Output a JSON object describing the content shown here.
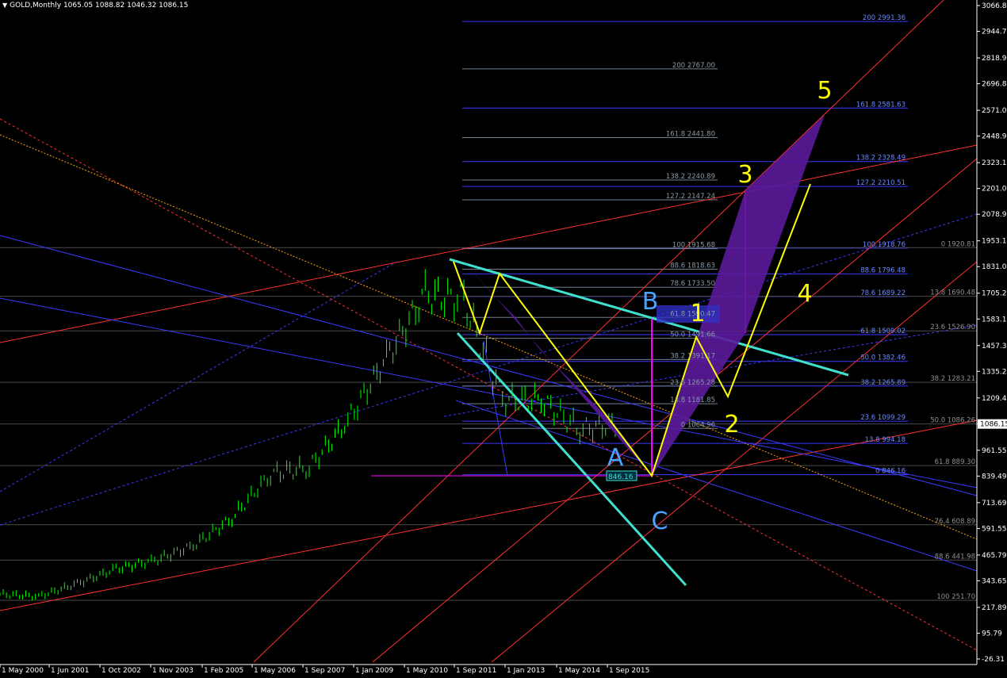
{
  "header": {
    "symbol": "GOLD,Monthly",
    "ohlc": "1065.05 1088.82 1046.32 1086.15",
    "menu_icon": "triangle-down-icon"
  },
  "colors": {
    "background": "#000000",
    "grid": "#4a4a4a",
    "candles": "#00ff00",
    "fib_blue": "#3a3aff",
    "fib_gray": "#708090",
    "channel_orange": "#ff4500",
    "channel_red": "#ff3030",
    "cyan": "#40e0d0",
    "yellow": "#ffff00",
    "magenta": "#ff00ff",
    "purple": "#5a1a9a",
    "label_blue": "#4aa3ff",
    "label_yellow": "#ffff00",
    "axis_text": "#ffffff"
  },
  "chart_data": {
    "type": "candlestick",
    "title": "GOLD,Monthly",
    "ylim": [
      -26.31,
      3066.89
    ],
    "y_ticks": [
      "3066.89",
      "2944.75",
      "2818.99",
      "2696.86",
      "2571.09",
      "2448.96",
      "2323.19",
      "2201.05",
      "2078.92",
      "1953.15",
      "1831.02",
      "1705.25",
      "1583.12",
      "1457.35",
      "1335.21",
      "1209.45",
      "1086.15",
      "961.55",
      "839.49",
      "713.69",
      "591.55",
      "465.79",
      "343.65",
      "217.89",
      "95.79",
      "-26.31"
    ],
    "x_ticks": [
      "1 May 2000",
      "1 Jun 2001",
      "1 Oct 2002",
      "1 Nov 2003",
      "1 Feb 2005",
      "1 May 2006",
      "1 Sep 2007",
      "1 Jan 2009",
      "1 May 2010",
      "1 Sep 2011",
      "1 Jan 2013",
      "1 May 2014",
      "1 Sep 2015"
    ],
    "current_price": "1086.15",
    "price_tag": "846.16",
    "price_series": [
      {
        "date": "2000",
        "close": 280
      },
      {
        "date": "2001",
        "close": 270
      },
      {
        "date": "2002",
        "close": 330
      },
      {
        "date": "2003",
        "close": 400
      },
      {
        "date": "2004",
        "close": 440
      },
      {
        "date": "2005",
        "close": 510
      },
      {
        "date": "2006",
        "close": 640
      },
      {
        "date": "2007",
        "close": 850
      },
      {
        "date": "2008",
        "close": 880
      },
      {
        "date": "2009",
        "close": 1100
      },
      {
        "date": "2010",
        "close": 1400
      },
      {
        "date": "2011",
        "close": 1700
      },
      {
        "date": "2012",
        "close": 1670
      },
      {
        "date": "2013",
        "close": 1200
      },
      {
        "date": "2014",
        "close": 1200
      },
      {
        "date": "2015",
        "close": 1060
      },
      {
        "date": "2016",
        "close": 1086
      }
    ],
    "fib_labels_right": [
      "200 2991.36",
      "161.8 2581.63",
      "138.2 2328.49",
      "127.2 2210.51",
      "100 1918.76",
      "88.6 1796.48",
      "78.6 1689.22",
      "61.8 1509.02",
      "50.0 1382.46",
      "38.2 1265.89",
      "23.6 1099.29",
      "13.8 994.18",
      "0 846.16"
    ],
    "fib_labels_mid": [
      "200 2767.00",
      "161.8 2441.80",
      "138.2 2240.89",
      "127.2 2147.24",
      "100 1915.68",
      "88.6 1818.63",
      "78.6 1733.50",
      "61.8 1590.47",
      "50.0 1491.66",
      "38.2 1391.17",
      "23.6 1265.28",
      "13.8 1181.85",
      "0 1064.96"
    ],
    "retrace_labels": [
      "0 1920.81",
      "13.8 1690.48",
      "23.6 1526.90",
      "38.2 1283.21",
      "50.0 1086.26",
      "61.8 889.30",
      "76.4 608.89",
      "88.6 441.98",
      "100 251.70"
    ],
    "wave_labels": [
      {
        "text": "5",
        "color": "yellow"
      },
      {
        "text": "3",
        "color": "yellow"
      },
      {
        "text": "1",
        "color": "yellow"
      },
      {
        "text": "4",
        "color": "yellow"
      },
      {
        "text": "2",
        "color": "yellow"
      },
      {
        "text": "B",
        "color": "blue"
      },
      {
        "text": "A",
        "color": "blue"
      },
      {
        "text": "C",
        "color": "blue"
      }
    ]
  }
}
